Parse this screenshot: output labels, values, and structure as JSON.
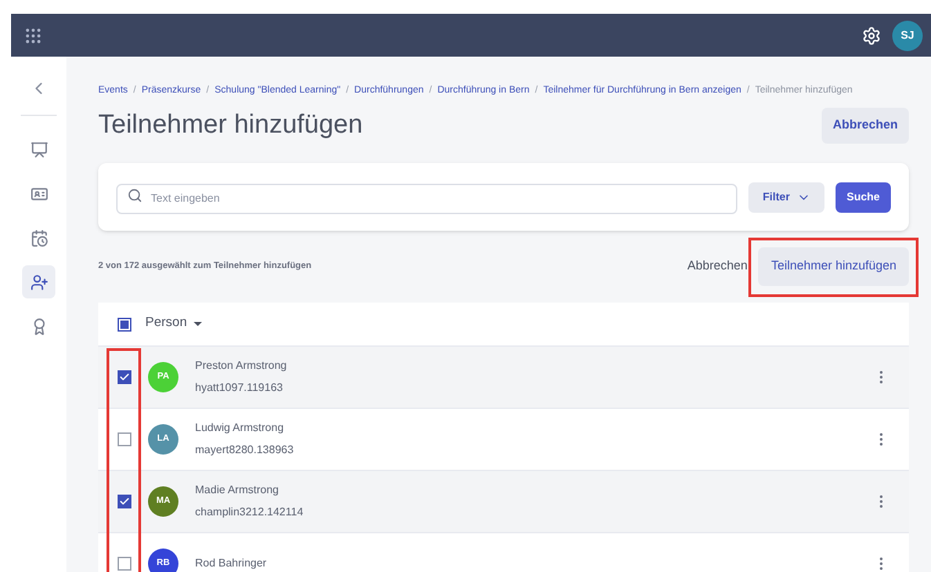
{
  "top_bar": {
    "avatar": "SJ"
  },
  "sidebar": {
    "items": [
      {
        "kind": "presentation",
        "selected": false
      },
      {
        "kind": "card",
        "selected": false
      },
      {
        "kind": "calendar",
        "selected": false
      },
      {
        "kind": "person-add",
        "selected": true
      },
      {
        "kind": "award",
        "selected": false
      }
    ]
  },
  "breadcrumb": [
    {
      "label": "Events",
      "current": false
    },
    {
      "separator": "/",
      "label": "Präsenzkurse",
      "current": false
    },
    {
      "separator": "/",
      "label": "Schulung \"Blended Learning\"",
      "current": false
    },
    {
      "separator": "/",
      "label": "Durchführungen",
      "current": false
    },
    {
      "separator": "/",
      "label": "Durchführung in Bern",
      "current": false
    },
    {
      "separator": "/",
      "label": "Teilnehmer für Durchführung in Bern anzeigen",
      "current": false
    },
    {
      "separator": "/",
      "label": "Teilnehmer hinzufügen",
      "current": true
    }
  ],
  "page_title": "Teilnehmer hinzufügen",
  "header_cancel": "Abbrechen",
  "search": {
    "placeholder": "Text eingeben",
    "filter": "Filter",
    "submit": "Suche"
  },
  "selection_info": "2 von 172 ausgewählt zum Teilnehmer hinzufügen",
  "cancel": "Abbrechen",
  "add_button": "Teilnehmer hinzufügen",
  "table": {
    "column": "Person",
    "select_all": {
      "checked": false,
      "indeterminate": true
    },
    "rows": [
      {
        "initials": "PA",
        "color": "#4cd137",
        "name": "Preston Armstrong",
        "username": "hyatt1097.119163",
        "selected": true
      },
      {
        "initials": "LA",
        "color": "#5592a8",
        "name": "Ludwig Armstrong",
        "username": "mayert8280.138963",
        "selected": false
      },
      {
        "initials": "MA",
        "color": "#5f7f22",
        "name": "Madie Armstrong",
        "username": "champlin3212.142114",
        "selected": true
      },
      {
        "initials": "RB",
        "color": "#3444d8",
        "name": "Rod Bahringer",
        "selected": false
      }
    ]
  }
}
